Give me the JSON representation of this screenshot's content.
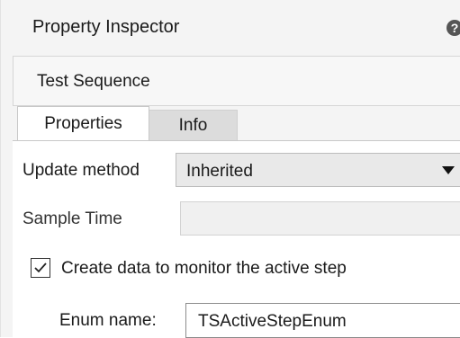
{
  "panel": {
    "title": "Property Inspector",
    "help_icon": "?",
    "close_icon": "×"
  },
  "object": {
    "name": "Test Sequence"
  },
  "tabs": [
    {
      "label": "Properties",
      "active": true
    },
    {
      "label": "Info",
      "active": false
    }
  ],
  "properties": {
    "update_method": {
      "label": "Update method",
      "value": "Inherited"
    },
    "sample_time": {
      "label": "Sample Time",
      "value": ""
    },
    "monitor_active_step": {
      "label": "Create data to monitor the active step",
      "checked": true
    },
    "enum_name": {
      "label": "Enum name:",
      "value": "TSActiveStepEnum"
    }
  }
}
